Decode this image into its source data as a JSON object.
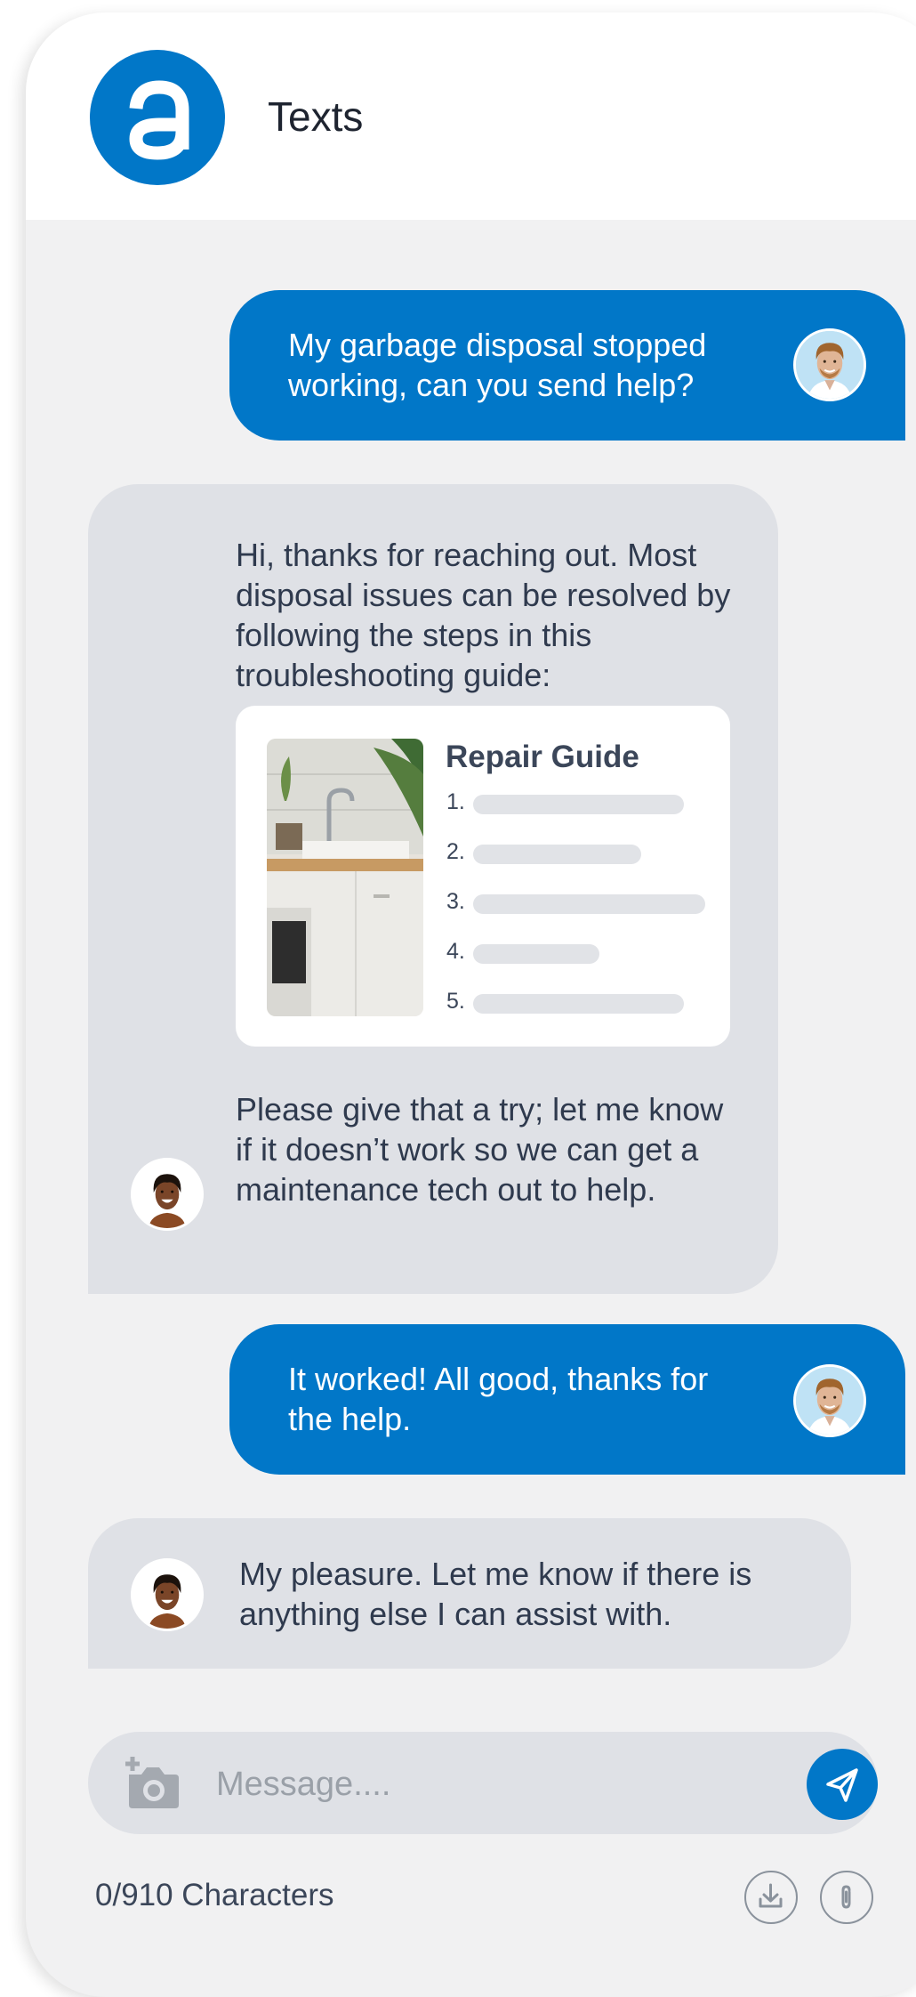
{
  "header": {
    "title": "Texts",
    "logo_icon": "a-logo-icon"
  },
  "colors": {
    "accent": "#0177c8",
    "incoming_bubble": "#dfe1e6",
    "background": "#f1f1f2"
  },
  "messages": [
    {
      "direction": "outgoing",
      "text": "My garbage disposal stopped working, can you send help?",
      "avatar": "customer-avatar"
    },
    {
      "direction": "incoming",
      "text_before": "Hi, thanks for reaching out. Most disposal issues can be resolved by following the steps in this troubleshooting guide:",
      "text_after": "Please give that a try; let me know if it doesn’t work so we can get a maintenance tech out to help.",
      "avatar": "agent-avatar"
    },
    {
      "direction": "outgoing",
      "text": "It worked! All good, thanks for the help.",
      "avatar": "customer-avatar"
    },
    {
      "direction": "incoming",
      "text": "My pleasure. Let me know if there is anything else I can assist with.",
      "avatar": "agent-avatar"
    }
  ],
  "guide": {
    "title": "Repair Guide",
    "steps": [
      "1.",
      "2.",
      "3.",
      "4.",
      "5."
    ]
  },
  "composer": {
    "placeholder": "Message....",
    "value": "",
    "char_count": "0/910 Characters"
  },
  "icons": [
    "camera-plus-icon",
    "send-icon",
    "download-icon",
    "paperclip-icon"
  ]
}
